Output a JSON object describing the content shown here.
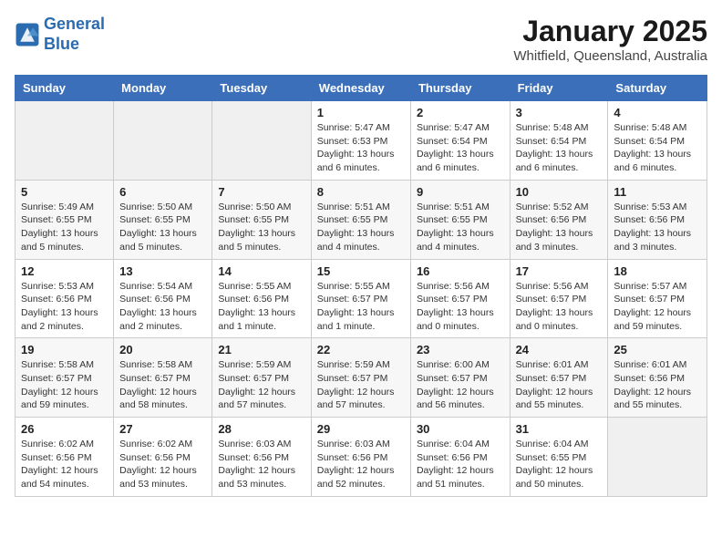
{
  "header": {
    "logo_line1": "General",
    "logo_line2": "Blue",
    "month_title": "January 2025",
    "location": "Whitfield, Queensland, Australia"
  },
  "weekdays": [
    "Sunday",
    "Monday",
    "Tuesday",
    "Wednesday",
    "Thursday",
    "Friday",
    "Saturday"
  ],
  "weeks": [
    [
      {
        "day": "",
        "info": ""
      },
      {
        "day": "",
        "info": ""
      },
      {
        "day": "",
        "info": ""
      },
      {
        "day": "1",
        "info": "Sunrise: 5:47 AM\nSunset: 6:53 PM\nDaylight: 13 hours\nand 6 minutes."
      },
      {
        "day": "2",
        "info": "Sunrise: 5:47 AM\nSunset: 6:54 PM\nDaylight: 13 hours\nand 6 minutes."
      },
      {
        "day": "3",
        "info": "Sunrise: 5:48 AM\nSunset: 6:54 PM\nDaylight: 13 hours\nand 6 minutes."
      },
      {
        "day": "4",
        "info": "Sunrise: 5:48 AM\nSunset: 6:54 PM\nDaylight: 13 hours\nand 6 minutes."
      }
    ],
    [
      {
        "day": "5",
        "info": "Sunrise: 5:49 AM\nSunset: 6:55 PM\nDaylight: 13 hours\nand 5 minutes."
      },
      {
        "day": "6",
        "info": "Sunrise: 5:50 AM\nSunset: 6:55 PM\nDaylight: 13 hours\nand 5 minutes."
      },
      {
        "day": "7",
        "info": "Sunrise: 5:50 AM\nSunset: 6:55 PM\nDaylight: 13 hours\nand 5 minutes."
      },
      {
        "day": "8",
        "info": "Sunrise: 5:51 AM\nSunset: 6:55 PM\nDaylight: 13 hours\nand 4 minutes."
      },
      {
        "day": "9",
        "info": "Sunrise: 5:51 AM\nSunset: 6:55 PM\nDaylight: 13 hours\nand 4 minutes."
      },
      {
        "day": "10",
        "info": "Sunrise: 5:52 AM\nSunset: 6:56 PM\nDaylight: 13 hours\nand 3 minutes."
      },
      {
        "day": "11",
        "info": "Sunrise: 5:53 AM\nSunset: 6:56 PM\nDaylight: 13 hours\nand 3 minutes."
      }
    ],
    [
      {
        "day": "12",
        "info": "Sunrise: 5:53 AM\nSunset: 6:56 PM\nDaylight: 13 hours\nand 2 minutes."
      },
      {
        "day": "13",
        "info": "Sunrise: 5:54 AM\nSunset: 6:56 PM\nDaylight: 13 hours\nand 2 minutes."
      },
      {
        "day": "14",
        "info": "Sunrise: 5:55 AM\nSunset: 6:56 PM\nDaylight: 13 hours\nand 1 minute."
      },
      {
        "day": "15",
        "info": "Sunrise: 5:55 AM\nSunset: 6:57 PM\nDaylight: 13 hours\nand 1 minute."
      },
      {
        "day": "16",
        "info": "Sunrise: 5:56 AM\nSunset: 6:57 PM\nDaylight: 13 hours\nand 0 minutes."
      },
      {
        "day": "17",
        "info": "Sunrise: 5:56 AM\nSunset: 6:57 PM\nDaylight: 13 hours\nand 0 minutes."
      },
      {
        "day": "18",
        "info": "Sunrise: 5:57 AM\nSunset: 6:57 PM\nDaylight: 12 hours\nand 59 minutes."
      }
    ],
    [
      {
        "day": "19",
        "info": "Sunrise: 5:58 AM\nSunset: 6:57 PM\nDaylight: 12 hours\nand 59 minutes."
      },
      {
        "day": "20",
        "info": "Sunrise: 5:58 AM\nSunset: 6:57 PM\nDaylight: 12 hours\nand 58 minutes."
      },
      {
        "day": "21",
        "info": "Sunrise: 5:59 AM\nSunset: 6:57 PM\nDaylight: 12 hours\nand 57 minutes."
      },
      {
        "day": "22",
        "info": "Sunrise: 5:59 AM\nSunset: 6:57 PM\nDaylight: 12 hours\nand 57 minutes."
      },
      {
        "day": "23",
        "info": "Sunrise: 6:00 AM\nSunset: 6:57 PM\nDaylight: 12 hours\nand 56 minutes."
      },
      {
        "day": "24",
        "info": "Sunrise: 6:01 AM\nSunset: 6:57 PM\nDaylight: 12 hours\nand 55 minutes."
      },
      {
        "day": "25",
        "info": "Sunrise: 6:01 AM\nSunset: 6:56 PM\nDaylight: 12 hours\nand 55 minutes."
      }
    ],
    [
      {
        "day": "26",
        "info": "Sunrise: 6:02 AM\nSunset: 6:56 PM\nDaylight: 12 hours\nand 54 minutes."
      },
      {
        "day": "27",
        "info": "Sunrise: 6:02 AM\nSunset: 6:56 PM\nDaylight: 12 hours\nand 53 minutes."
      },
      {
        "day": "28",
        "info": "Sunrise: 6:03 AM\nSunset: 6:56 PM\nDaylight: 12 hours\nand 53 minutes."
      },
      {
        "day": "29",
        "info": "Sunrise: 6:03 AM\nSunset: 6:56 PM\nDaylight: 12 hours\nand 52 minutes."
      },
      {
        "day": "30",
        "info": "Sunrise: 6:04 AM\nSunset: 6:56 PM\nDaylight: 12 hours\nand 51 minutes."
      },
      {
        "day": "31",
        "info": "Sunrise: 6:04 AM\nSunset: 6:55 PM\nDaylight: 12 hours\nand 50 minutes."
      },
      {
        "day": "",
        "info": ""
      }
    ]
  ]
}
